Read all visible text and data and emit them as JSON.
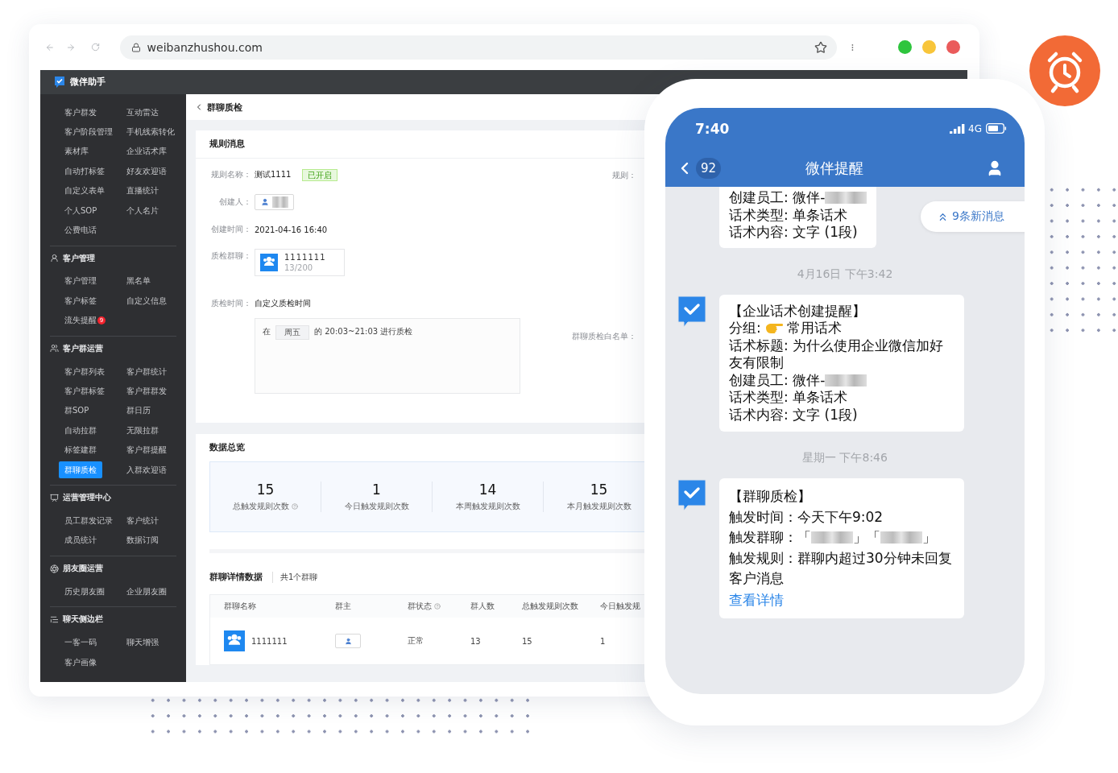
{
  "browser": {
    "url": "weibanzhushou.com"
  },
  "app": {
    "name": "微伴助手"
  },
  "sidebar": {
    "sections": [
      {
        "items": [
          {
            "label": "客户群发",
            "selected": false
          },
          {
            "label": "互动雷达",
            "selected": false
          },
          {
            "label": "客户阶段管理",
            "selected": false
          },
          {
            "label": "手机线索转化",
            "selected": false
          },
          {
            "label": "素材库",
            "selected": false
          },
          {
            "label": "企业话术库",
            "selected": false
          },
          {
            "label": "自动打标签",
            "selected": false
          },
          {
            "label": "好友欢迎语",
            "selected": false
          },
          {
            "label": "自定义表单",
            "selected": false
          },
          {
            "label": "直播统计",
            "selected": false
          },
          {
            "label": "个人SOP",
            "selected": false
          },
          {
            "label": "个人名片",
            "selected": false
          },
          {
            "label": "公费电话",
            "selected": false
          }
        ]
      },
      {
        "title": "客户管理",
        "items": [
          {
            "label": "客户管理",
            "selected": false
          },
          {
            "label": "黑名单",
            "selected": false
          },
          {
            "label": "客户标签",
            "selected": false
          },
          {
            "label": "自定义信息",
            "selected": false
          },
          {
            "label": "流失提醒",
            "selected": false,
            "badge": "9"
          }
        ]
      },
      {
        "title": "客户群运营",
        "items": [
          {
            "label": "客户群列表",
            "selected": false
          },
          {
            "label": "客户群统计",
            "selected": false
          },
          {
            "label": "客户群标签",
            "selected": false
          },
          {
            "label": "客户群群发",
            "selected": false
          },
          {
            "label": "群SOP",
            "selected": false
          },
          {
            "label": "群日历",
            "selected": false
          },
          {
            "label": "自动拉群",
            "selected": false
          },
          {
            "label": "无限拉群",
            "selected": false
          },
          {
            "label": "标签建群",
            "selected": false
          },
          {
            "label": "客户群提醒",
            "selected": false
          },
          {
            "label": "群聊质检",
            "selected": true
          },
          {
            "label": "入群欢迎语",
            "selected": false
          }
        ]
      },
      {
        "title": "运营管理中心",
        "items": [
          {
            "label": "员工群发记录",
            "selected": false
          },
          {
            "label": "客户统计",
            "selected": false
          },
          {
            "label": "成员统计",
            "selected": false
          },
          {
            "label": "数据订阅",
            "selected": false
          }
        ]
      },
      {
        "title": "朋友圈运营",
        "items": [
          {
            "label": "历史朋友圈",
            "selected": false
          },
          {
            "label": "企业朋友圈",
            "selected": false
          }
        ]
      },
      {
        "title": "聊天侧边栏",
        "items": [
          {
            "label": "一客一码",
            "selected": false
          },
          {
            "label": "聊天增强",
            "selected": false
          },
          {
            "label": "客户画像",
            "selected": false
          }
        ]
      }
    ]
  },
  "page": {
    "title": "群聊质检"
  },
  "rule_card": {
    "title": "规则消息",
    "fields": [
      {
        "kind": "text",
        "label": "规则名称：",
        "value": "测试1111",
        "tag": "已开启"
      },
      {
        "kind": "user",
        "label": "创建人："
      },
      {
        "kind": "text",
        "label": "创建时间：",
        "value": "2021-04-16 16:40"
      },
      {
        "kind": "group",
        "label": "质检群聊：",
        "name": "1111111",
        "members": "13/200"
      },
      {
        "kind": "schedule",
        "label": "质检时间：",
        "value": "自定义质检时间",
        "prefix": "在",
        "day": "周五",
        "suffix": "的 20:03~21:03 进行质检"
      }
    ],
    "side_labels": [
      "规则：",
      "群聊质检白名单："
    ]
  },
  "stats": {
    "title": "数据总览",
    "items": [
      {
        "value": "15",
        "label": "总触发规则次数",
        "help": true
      },
      {
        "value": "1",
        "label": "今日触发规则次数",
        "help": false
      },
      {
        "value": "14",
        "label": "本周触发规则次数",
        "help": false
      },
      {
        "value": "15",
        "label": "本月触发规则次数",
        "help": false
      }
    ]
  },
  "table": {
    "title": "群聊详情数据",
    "count": "共1个群聊",
    "columns": [
      {
        "label": "群聊名称",
        "help": false
      },
      {
        "label": "群主",
        "help": false
      },
      {
        "label": "群状态",
        "help": true
      },
      {
        "label": "群人数",
        "help": false
      },
      {
        "label": "总触发规则次数",
        "help": false
      },
      {
        "label": "今日触发规",
        "help": false
      }
    ],
    "rows": [
      {
        "name": "1111111",
        "status": "正常",
        "members": "13",
        "total": "15",
        "today": "1"
      }
    ]
  },
  "phone": {
    "time": "7:40",
    "network": "4G",
    "unread": "92",
    "title": "微伴提醒",
    "new_messages": "9条新消息",
    "feed": [
      {
        "kind": "message",
        "cut": true,
        "lines": [
          [
            {
              "kind": "text",
              "text": "创建员工: 微伴-"
            },
            {
              "kind": "blur"
            }
          ],
          [
            {
              "kind": "text",
              "text": "话术类型: 单条话术"
            }
          ],
          [
            {
              "kind": "text",
              "text": "话术内容: 文字 (1段)"
            }
          ]
        ]
      },
      {
        "kind": "time",
        "text": "4月16日 下午3:42"
      },
      {
        "kind": "message",
        "cut": false,
        "lines": [
          [
            {
              "kind": "text",
              "text": "【企业话术创建提醒】"
            }
          ],
          [
            {
              "kind": "text",
              "text": "分组:"
            },
            {
              "kind": "emoji"
            },
            {
              "kind": "text",
              "text": "常用话术"
            }
          ],
          [
            {
              "kind": "text",
              "text": "话术标题: 为什么使用企业微信加好友有限制"
            }
          ],
          [
            {
              "kind": "text",
              "text": "创建员工: 微伴-"
            },
            {
              "kind": "blur"
            }
          ],
          [
            {
              "kind": "text",
              "text": "话术类型: 单条话术"
            }
          ],
          [
            {
              "kind": "text",
              "text": "话术内容: 文字 (1段)"
            }
          ]
        ]
      },
      {
        "kind": "time",
        "text": "星期一 下午8:46"
      },
      {
        "kind": "message",
        "cut": false,
        "loose": true,
        "lines": [
          [
            {
              "kind": "text",
              "text": "【群聊质检】"
            }
          ],
          [
            {
              "kind": "text",
              "text": "触发时间：今天下午9:02"
            }
          ],
          [
            {
              "kind": "text",
              "text": "触发群聊：「"
            },
            {
              "kind": "blur"
            },
            {
              "kind": "text",
              "text": "」「"
            },
            {
              "kind": "blur"
            },
            {
              "kind": "text",
              "text": "」"
            }
          ],
          [
            {
              "kind": "text",
              "text": "触发规则：群聊内超过30分钟未回复客户消息"
            }
          ]
        ],
        "link": "查看详情"
      }
    ]
  }
}
